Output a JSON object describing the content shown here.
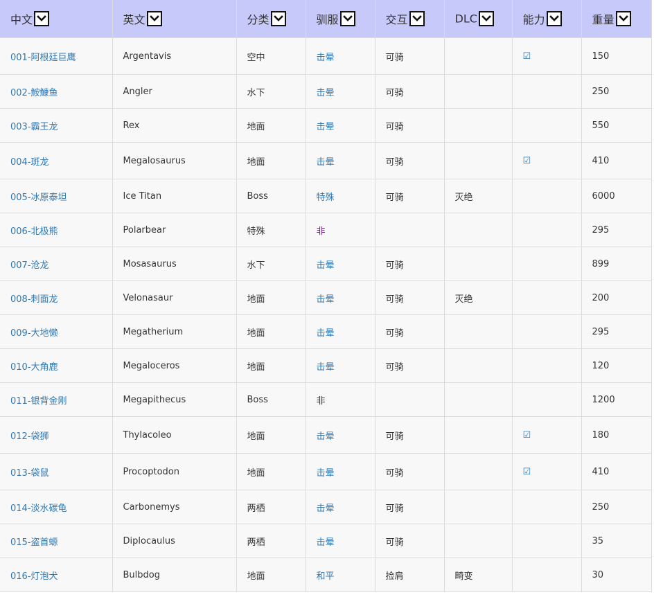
{
  "table": {
    "headers": [
      "中文",
      "英文",
      "分类",
      "驯服",
      "交互",
      "DLC",
      "能力",
      "重量"
    ],
    "rows": [
      {
        "cn": "001-阿根廷巨鹰",
        "en": "Argentavis",
        "cat": "空中",
        "tame": "击晕",
        "tame_style": "link",
        "interact": "可骑",
        "dlc": "",
        "ability": "☑",
        "weight": "150"
      },
      {
        "cn": "002-鮟鱇鱼",
        "en": "Angler",
        "cat": "水下",
        "tame": "击晕",
        "tame_style": "link",
        "interact": "可骑",
        "dlc": "",
        "ability": "",
        "weight": "250"
      },
      {
        "cn": "003-霸王龙",
        "en": "Rex",
        "cat": "地面",
        "tame": "击晕",
        "tame_style": "link",
        "interact": "可骑",
        "dlc": "",
        "ability": "",
        "weight": "550"
      },
      {
        "cn": "004-斑龙",
        "en": "Megalosaurus",
        "cat": "地面",
        "tame": "击晕",
        "tame_style": "link",
        "interact": "可骑",
        "dlc": "",
        "ability": "☑",
        "weight": "410"
      },
      {
        "cn": "005-冰原泰坦",
        "en": "Ice Titan",
        "cat": "Boss",
        "tame": "特殊",
        "tame_style": "link",
        "interact": "可骑",
        "dlc": "灭绝",
        "ability": "",
        "weight": "6000"
      },
      {
        "cn": "006-北极熊",
        "en": "Polarbear",
        "cat": "特殊",
        "tame": "非",
        "tame_style": "visited",
        "interact": "",
        "dlc": "",
        "ability": "",
        "weight": "295"
      },
      {
        "cn": "007-沧龙",
        "en": "Mosasaurus",
        "cat": "水下",
        "tame": "击晕",
        "tame_style": "link",
        "interact": "可骑",
        "dlc": "",
        "ability": "",
        "weight": "899"
      },
      {
        "cn": "008-刺面龙",
        "en": "Velonasaur",
        "cat": "地面",
        "tame": "击晕",
        "tame_style": "link",
        "interact": "可骑",
        "dlc": "灭绝",
        "ability": "",
        "weight": "200"
      },
      {
        "cn": "009-大地懒",
        "en": "Megatherium",
        "cat": "地面",
        "tame": "击晕",
        "tame_style": "link",
        "interact": "可骑",
        "dlc": "",
        "ability": "",
        "weight": "295"
      },
      {
        "cn": "010-大角鹿",
        "en": "Megaloceros",
        "cat": "地面",
        "tame": "击晕",
        "tame_style": "link",
        "interact": "可骑",
        "dlc": "",
        "ability": "",
        "weight": "120"
      },
      {
        "cn": "011-银背金刚",
        "en": "Megapithecus",
        "cat": "Boss",
        "tame": "非",
        "tame_style": "plain",
        "interact": "",
        "dlc": "",
        "ability": "",
        "weight": "1200"
      },
      {
        "cn": "012-袋狮",
        "en": "Thylacoleo",
        "cat": "地面",
        "tame": "击晕",
        "tame_style": "link",
        "interact": "可骑",
        "dlc": "",
        "ability": "☑",
        "weight": "180"
      },
      {
        "cn": "013-袋鼠",
        "en": "Procoptodon",
        "cat": "地面",
        "tame": "击晕",
        "tame_style": "link",
        "interact": "可骑",
        "dlc": "",
        "ability": "☑",
        "weight": "410"
      },
      {
        "cn": "014-淡水碳龟",
        "en": "Carbonemys",
        "cat": "两栖",
        "tame": "击晕",
        "tame_style": "link",
        "interact": "可骑",
        "dlc": "",
        "ability": "",
        "weight": "250"
      },
      {
        "cn": "015-盗首螈",
        "en": "Diplocaulus",
        "cat": "两栖",
        "tame": "击晕",
        "tame_style": "link",
        "interact": "可骑",
        "dlc": "",
        "ability": "",
        "weight": "35"
      },
      {
        "cn": "016-灯泡犬",
        "en": "Bulbdog",
        "cat": "地面",
        "tame": "和平",
        "tame_style": "link",
        "interact": "捡肩",
        "dlc": "畸变",
        "ability": "",
        "weight": "30"
      }
    ]
  },
  "colors": {
    "header_bg": "#c8c9fb",
    "link": "#2f78b4",
    "link_visited": "#7a1f8e",
    "row_bg": "#f8f8f8",
    "border": "#dcdcdc"
  },
  "icons": {
    "sort": "chevron-down-icon",
    "ability": "checkbox-checked-icon"
  }
}
